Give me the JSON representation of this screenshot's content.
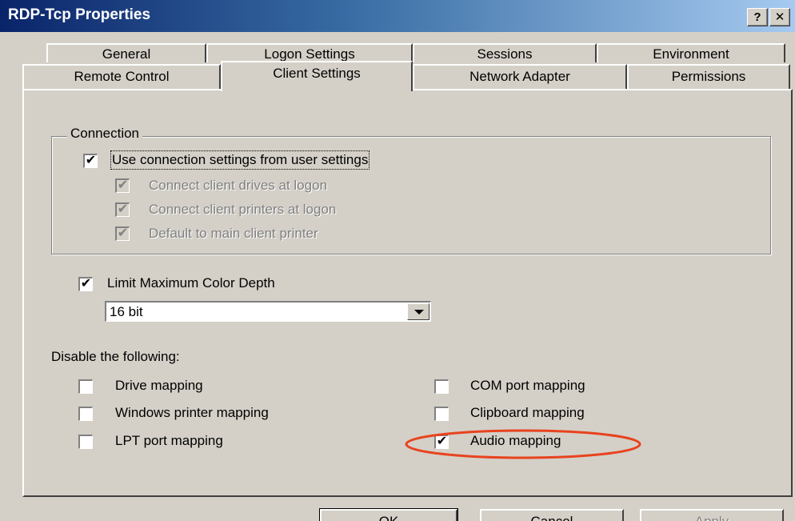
{
  "window": {
    "title": "RDP-Tcp Properties",
    "help_button": "?",
    "close_button": "X"
  },
  "tabs": {
    "row1": [
      {
        "label": "General"
      },
      {
        "label": "Logon Settings"
      },
      {
        "label": "Sessions"
      },
      {
        "label": "Environment"
      }
    ],
    "row2": [
      {
        "label": "Remote Control"
      },
      {
        "label": "Client Settings",
        "active": true
      },
      {
        "label": "Network Adapter"
      },
      {
        "label": "Permissions"
      }
    ]
  },
  "connection": {
    "legend": "Connection",
    "use_user_settings": {
      "label": "Use connection settings from user settings",
      "checked": true
    },
    "options": [
      {
        "label": "Connect client drives at logon",
        "checked": true,
        "disabled": true
      },
      {
        "label": "Connect client printers at logon",
        "checked": true,
        "disabled": true
      },
      {
        "label": "Default to main client printer",
        "checked": true,
        "disabled": true
      }
    ]
  },
  "color_depth": {
    "label": "Limit Maximum Color Depth",
    "checked": true,
    "selected": "16 bit"
  },
  "disable": {
    "heading": "Disable the following:",
    "left": [
      {
        "label": "Drive mapping",
        "checked": false
      },
      {
        "label": "Windows printer mapping",
        "checked": false
      },
      {
        "label": "LPT port mapping",
        "checked": false
      }
    ],
    "right": [
      {
        "label": "COM port mapping",
        "checked": false
      },
      {
        "label": "Clipboard mapping",
        "checked": false
      },
      {
        "label": "Audio mapping",
        "checked": true
      }
    ]
  },
  "buttons": {
    "ok": "OK",
    "cancel": "Cancel",
    "apply": "Apply"
  },
  "colors": {
    "title_gradient_start": "#0a246a",
    "title_gradient_end": "#a6caf0",
    "dialog_face": "#d4d0c8",
    "highlight_ellipse": "#e8431e"
  }
}
